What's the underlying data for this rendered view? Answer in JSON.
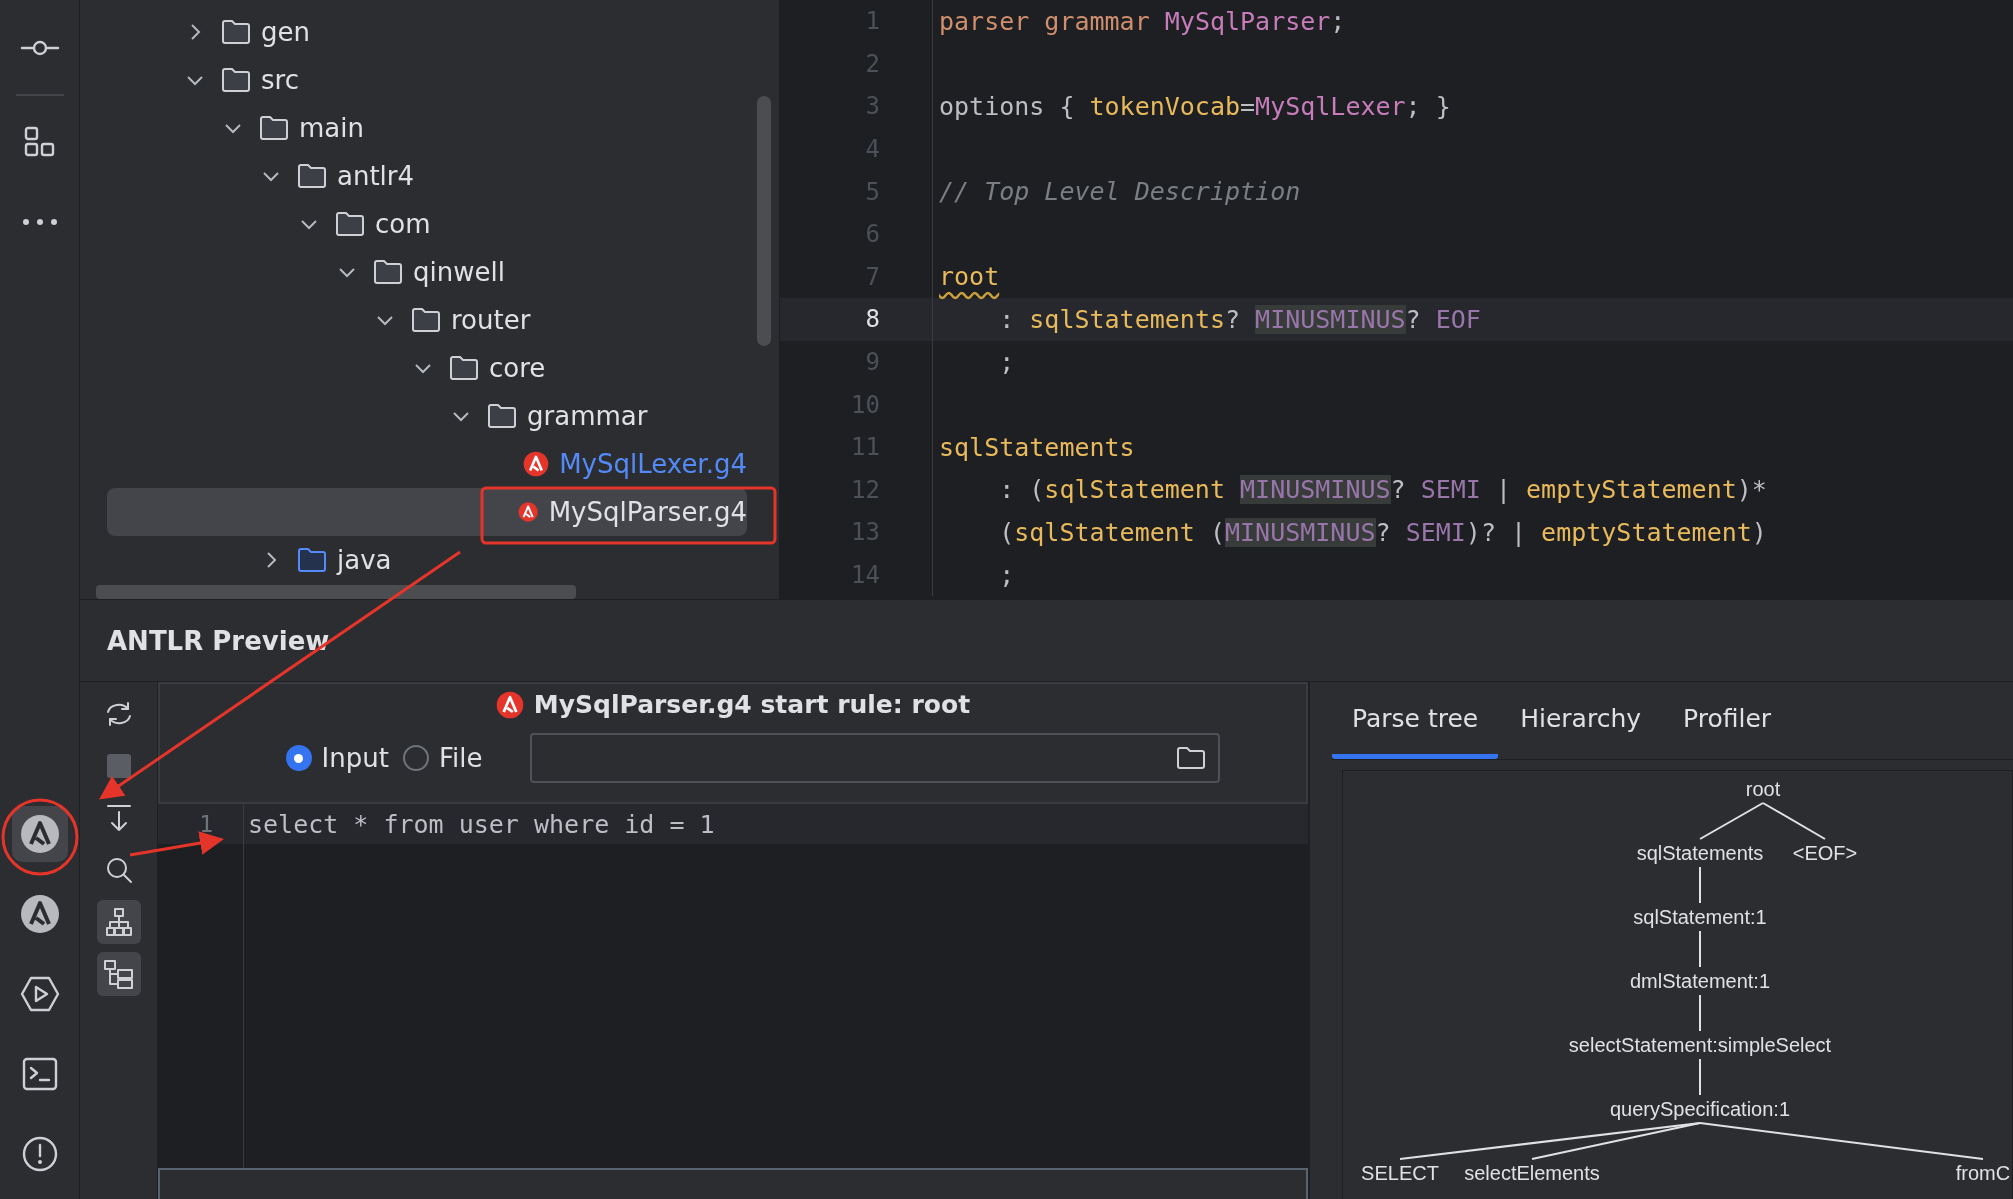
{
  "tool_stripe": [
    {
      "kind": "commit",
      "selected": false
    },
    {
      "kind": "structure",
      "selected": false
    },
    {
      "kind": "more",
      "selected": false
    },
    {
      "kind": "antlr",
      "selected": true
    },
    {
      "kind": "antlr",
      "selected": false
    },
    {
      "kind": "run",
      "selected": false
    },
    {
      "kind": "terminal",
      "selected": false
    },
    {
      "kind": "problems",
      "selected": false
    }
  ],
  "project_tree": [
    {
      "label": "gen",
      "kind": "folder",
      "expanded": false
    },
    {
      "label": "src",
      "kind": "folder",
      "expanded": true,
      "children": [
        {
          "label": "main",
          "kind": "folder",
          "expanded": true,
          "children": [
            {
              "label": "antlr4",
              "kind": "folder",
              "expanded": true,
              "children": [
                {
                  "label": "com",
                  "kind": "folder",
                  "expanded": true,
                  "children": [
                    {
                      "label": "qinwell",
                      "kind": "folder",
                      "expanded": true,
                      "children": [
                        {
                          "label": "router",
                          "kind": "folder",
                          "expanded": true,
                          "children": [
                            {
                              "label": "core",
                              "kind": "folder",
                              "expanded": true,
                              "children": [
                                {
                                  "label": "grammar",
                                  "kind": "folder",
                                  "expanded": true,
                                  "children": [
                                    {
                                      "label": "MySqlLexer.g4",
                                      "kind": "grammar",
                                      "added": true,
                                      "selected": false
                                    },
                                    {
                                      "label": "MySqlParser.g4",
                                      "kind": "grammar",
                                      "added": false,
                                      "selected": true
                                    }
                                  ]
                                }
                              ]
                            }
                          ]
                        }
                      ]
                    }
                  ]
                }
              ]
            },
            {
              "label": "java",
              "kind": "source",
              "expanded": false
            }
          ]
        }
      ]
    }
  ],
  "editor": {
    "lines": [
      {
        "number": "1",
        "selected": false,
        "tokens": [
          {
            "text": "parser grammar ",
            "kind": "keyword"
          },
          {
            "text": "MySqlParser",
            "kind": "name"
          },
          {
            "text": ";",
            "kind": "plain"
          }
        ]
      },
      {
        "number": "2",
        "selected": false
      },
      {
        "number": "3",
        "selected": false,
        "tokens": [
          {
            "text": "options { ",
            "kind": "plain"
          },
          {
            "text": "tokenVocab",
            "kind": "ref"
          },
          {
            "text": "=",
            "kind": "plain"
          },
          {
            "text": "MySqlLexer",
            "kind": "name"
          },
          {
            "text": "; }",
            "kind": "plain"
          }
        ]
      },
      {
        "number": "4",
        "selected": false
      },
      {
        "number": "5",
        "selected": false,
        "tokens": [
          {
            "text": "// Top Level Description",
            "kind": "comment"
          }
        ]
      },
      {
        "number": "6",
        "selected": false
      },
      {
        "number": "7",
        "selected": false,
        "tokens": [
          {
            "text": "root",
            "kind": "warning"
          }
        ]
      },
      {
        "number": "8",
        "selected": true,
        "tokens": [
          {
            "text": "    : ",
            "kind": "plain"
          },
          {
            "text": "sqlStatements",
            "kind": "ref"
          },
          {
            "text": "? ",
            "kind": "plain"
          },
          {
            "text": "MINUSMINUS",
            "kind": "match"
          },
          {
            "text": "? ",
            "kind": "plain"
          },
          {
            "text": "EOF",
            "kind": "token"
          }
        ]
      },
      {
        "number": "9",
        "selected": false,
        "tokens": [
          {
            "text": "    ;",
            "kind": "plain"
          }
        ]
      },
      {
        "number": "10",
        "selected": false
      },
      {
        "number": "11",
        "selected": false,
        "tokens": [
          {
            "text": "sqlStatements",
            "kind": "ref"
          }
        ]
      },
      {
        "number": "12",
        "selected": false,
        "tokens": [
          {
            "text": "    : (",
            "kind": "plain"
          },
          {
            "text": "sqlStatement ",
            "kind": "ref"
          },
          {
            "text": "MINUSMINUS",
            "kind": "match"
          },
          {
            "text": "? ",
            "kind": "plain"
          },
          {
            "text": "SEMI",
            "kind": "token"
          },
          {
            "text": " | ",
            "kind": "plain"
          },
          {
            "text": "emptyStatement",
            "kind": "ref"
          },
          {
            "text": ")*",
            "kind": "plain"
          }
        ]
      },
      {
        "number": "13",
        "selected": false,
        "tokens": [
          {
            "text": "    (",
            "kind": "plain"
          },
          {
            "text": "sqlStatement",
            "kind": "ref"
          },
          {
            "text": " (",
            "kind": "plain"
          },
          {
            "text": "MINUSMINUS",
            "kind": "match"
          },
          {
            "text": "? ",
            "kind": "plain"
          },
          {
            "text": "SEMI",
            "kind": "token"
          },
          {
            "text": ")? | ",
            "kind": "plain"
          },
          {
            "text": "emptyStatement",
            "kind": "ref"
          },
          {
            "text": ")",
            "kind": "plain"
          }
        ]
      },
      {
        "number": "14",
        "selected": false,
        "tokens": [
          {
            "text": "    ;",
            "kind": "plain"
          }
        ]
      }
    ]
  },
  "preview": {
    "title": "ANTLR Preview",
    "toolbar": [
      {
        "kind": "refresh",
        "on": false
      },
      {
        "kind": "stop",
        "on": false
      },
      {
        "kind": "export",
        "on": false
      },
      {
        "kind": "search",
        "on": false
      },
      {
        "kind": "tree",
        "on": true
      },
      {
        "kind": "hierarchy",
        "on": true
      }
    ],
    "header": "MySqlParser.g4 start rule: root",
    "sources": [
      {
        "label": "Input",
        "selected": true
      },
      {
        "label": "File",
        "selected": false
      }
    ],
    "input_lines": [
      {
        "number": "1",
        "text": "select * from user where id = 1"
      }
    ],
    "tabs": [
      {
        "label": "Parse tree",
        "selected": true
      },
      {
        "label": "Hierarchy",
        "selected": false
      },
      {
        "label": "Profiler",
        "selected": false
      }
    ],
    "parse_tree": {
      "label": "root",
      "children": [
        {
          "label": "sqlStatements",
          "children": [
            {
              "label": "sqlStatement:1",
              "children": [
                {
                  "label": "dmlStatement:1",
                  "children": [
                    {
                      "label": "selectStatement:simpleSelect",
                      "children": [
                        {
                          "label": "querySpecification:1",
                          "children": [
                            {
                              "label": "SELECT"
                            },
                            {
                              "label": "selectElements"
                            },
                            {
                              "label": "fromC"
                            }
                          ]
                        }
                      ]
                    }
                  ]
                }
              ]
            }
          ]
        },
        {
          "label": "<EOF>"
        }
      ]
    }
  }
}
